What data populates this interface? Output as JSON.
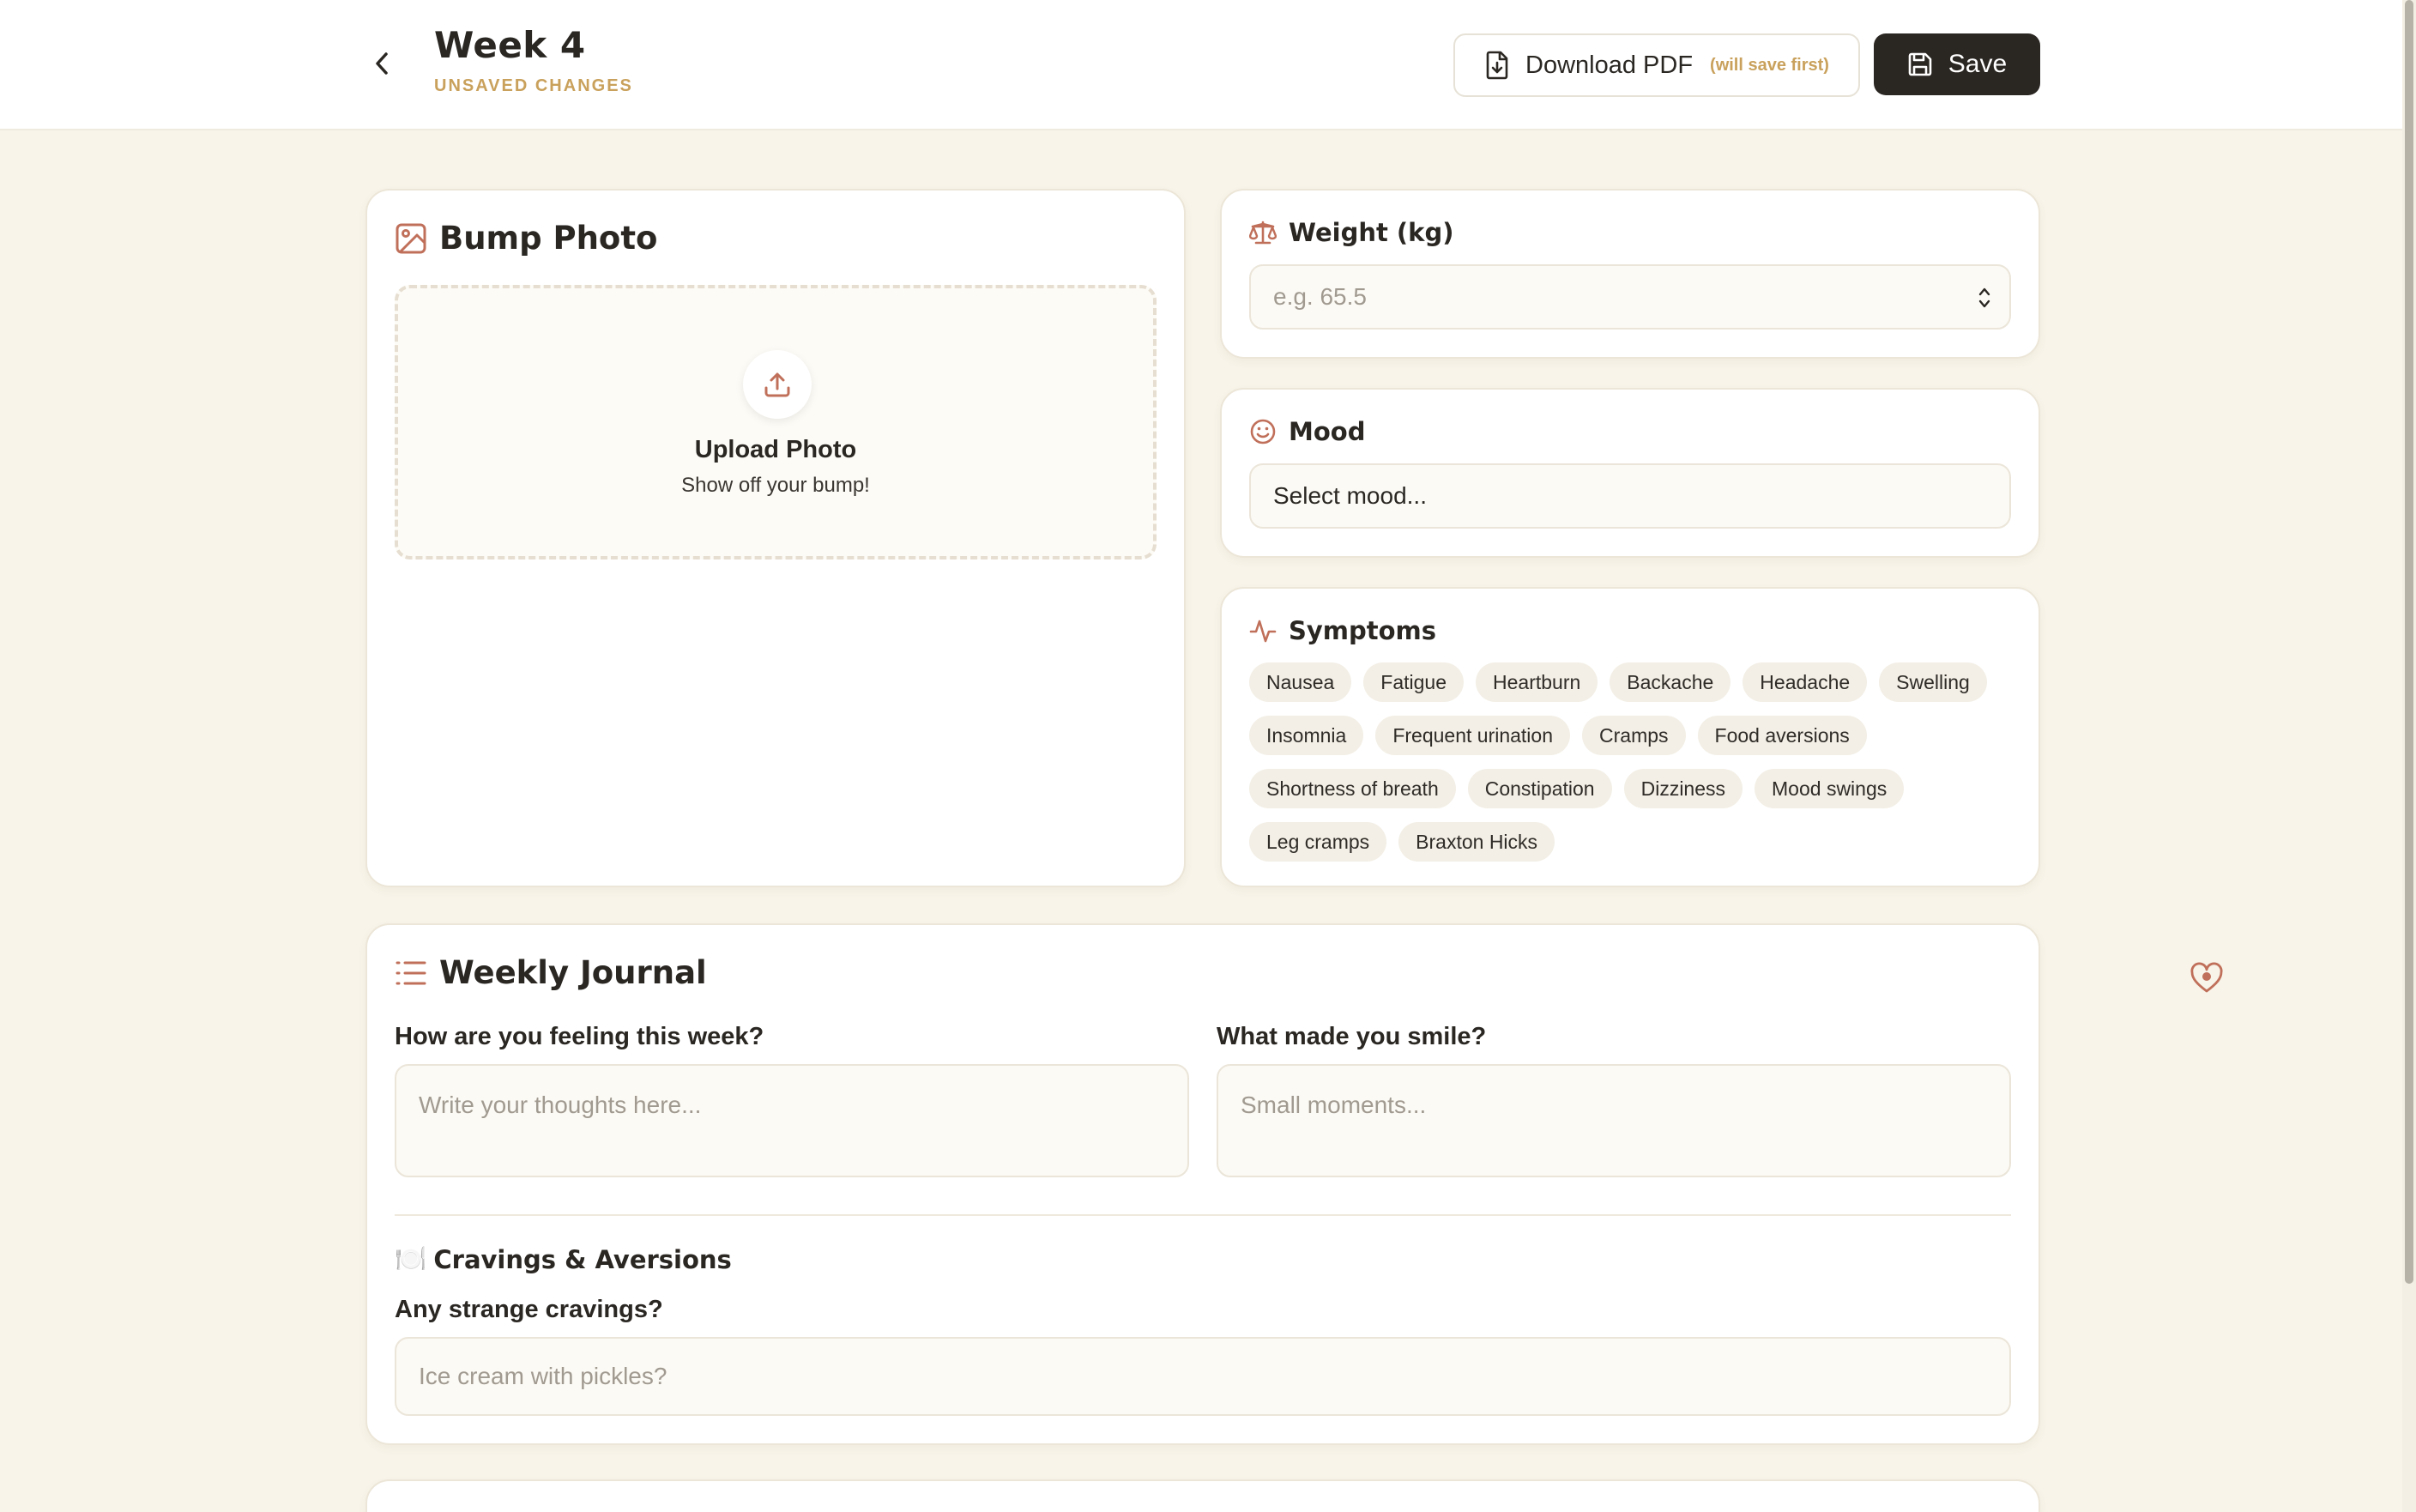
{
  "header": {
    "title": "Week 4",
    "status": "UNSAVED CHANGES",
    "download_label": "Download PDF",
    "download_hint": "(will save first)",
    "save_label": "Save"
  },
  "bump_photo": {
    "title": "Bump Photo",
    "upload_title": "Upload Photo",
    "upload_sub": "Show off your bump!"
  },
  "weight": {
    "title": "Weight (kg)",
    "placeholder": "e.g. 65.5"
  },
  "mood": {
    "title": "Mood",
    "selected": "Select mood..."
  },
  "symptoms": {
    "title": "Symptoms",
    "rows": [
      [
        "Nausea",
        "Fatigue",
        "Heartburn",
        "Backache",
        "Headache",
        "Swelling"
      ],
      [
        "Insomnia",
        "Frequent urination",
        "Cramps",
        "Food aversions"
      ],
      [
        "Shortness of breath",
        "Constipation",
        "Dizziness",
        "Mood swings"
      ],
      [
        "Leg cramps",
        "Braxton Hicks"
      ]
    ]
  },
  "journal": {
    "title": "Weekly Journal",
    "q1_label": "How are you feeling this week?",
    "q1_placeholder": "Write your thoughts here...",
    "q2_label": "What made you smile?",
    "q2_placeholder": "Small moments...",
    "cravings_title": "Cravings & Aversions",
    "cravings_emoji": "🍽️",
    "q3_label": "Any strange cravings?",
    "q3_placeholder": "Ice cream with pickles?"
  },
  "colors": {
    "accent": "#c0705a",
    "status": "#c9a15c",
    "dark_button": "#2a2622",
    "background": "#f8f4e9"
  },
  "icons": [
    "chevron-left-icon",
    "file-download-icon",
    "save-icon",
    "image-icon",
    "upload-icon",
    "scale-icon",
    "smile-icon",
    "activity-icon",
    "list-icon",
    "heart-icon"
  ]
}
